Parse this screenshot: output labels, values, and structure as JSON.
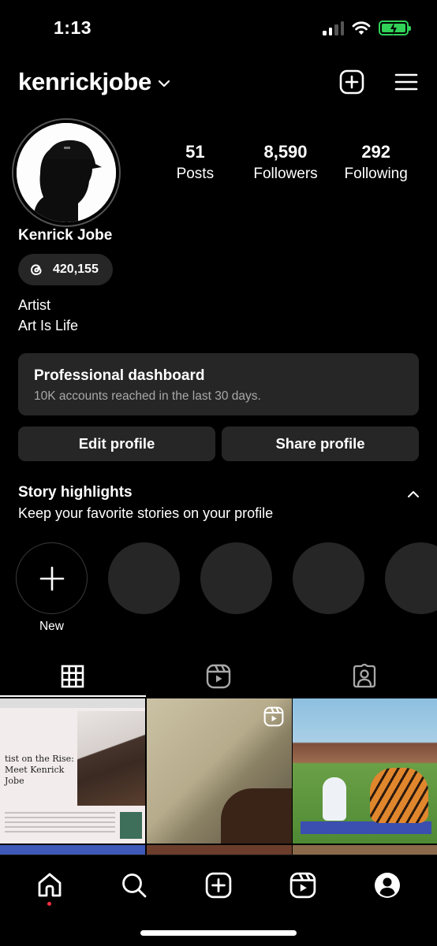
{
  "status_bar": {
    "time": "1:13"
  },
  "header": {
    "username": "kenrickjobe"
  },
  "profile": {
    "stats": [
      {
        "value": "51",
        "label": "Posts"
      },
      {
        "value": "8,590",
        "label": "Followers"
      },
      {
        "value": "292",
        "label": "Following"
      }
    ],
    "full_name": "Kenrick Jobe",
    "threads_count": "420,155",
    "bio_line1": "Artist",
    "bio_line2": "Art Is Life"
  },
  "dashboard": {
    "title": "Professional dashboard",
    "subtitle": "10K accounts reached in the last 30 days."
  },
  "buttons": {
    "edit": "Edit profile",
    "share": "Share profile"
  },
  "highlights": {
    "title": "Story highlights",
    "subtitle": "Keep your favorite stories on your profile",
    "new_label": "New"
  },
  "grid": {
    "post1_headline": "tist on the Rise: Meet Kenrick Jobe"
  },
  "colors": {
    "battery": "#31d158",
    "surface": "#262626",
    "notification": "#ff3040"
  }
}
